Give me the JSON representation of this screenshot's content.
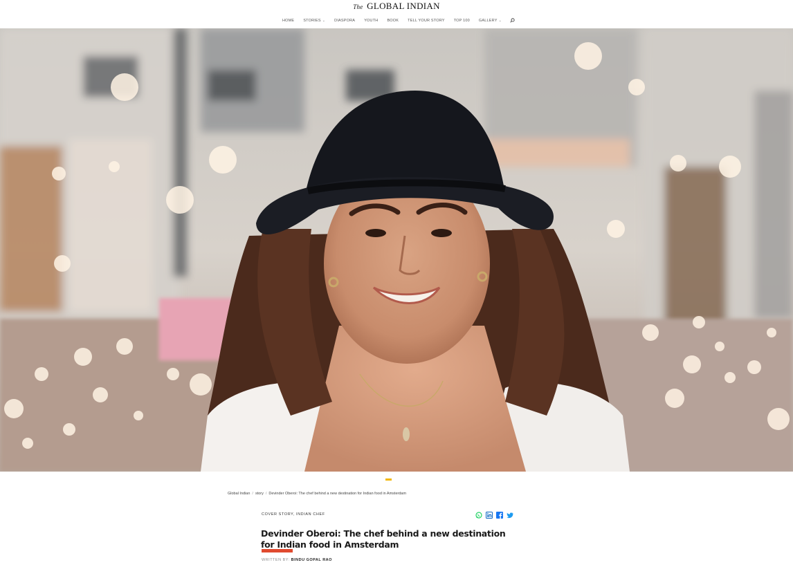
{
  "site": {
    "logo_the": "The",
    "logo_name": "GLOBAL INDIAN"
  },
  "nav": {
    "items": [
      {
        "label": "HOME",
        "has_dropdown": false
      },
      {
        "label": "STORIES",
        "has_dropdown": true
      },
      {
        "label": "DIASPORA",
        "has_dropdown": false
      },
      {
        "label": "YOUTH",
        "has_dropdown": false
      },
      {
        "label": "BOOK",
        "has_dropdown": false
      },
      {
        "label": "TELL YOUR STORY",
        "has_dropdown": false
      },
      {
        "label": "TOP 100",
        "has_dropdown": false
      },
      {
        "label": "GALLERY",
        "has_dropdown": true
      }
    ],
    "search_icon": "search-icon",
    "chevron_icon": "chevron-down-icon"
  },
  "hero": {
    "image_alt": "hero-photo"
  },
  "breadcrumb": {
    "items": [
      "Global Indian",
      "story",
      "Devinder Oberoi: The chef behind a new destination for Indian food in Amsterdam"
    ],
    "separator": "/"
  },
  "article": {
    "categories": "COVER STORY, INDIAN CHEF",
    "title": "Devinder Oberoi: The chef behind a new destination for Indian food in Amsterdam",
    "byline_prefix": "WRITTEN BY:",
    "author": "BINDU GOPAL RAO"
  },
  "share": {
    "icons": [
      "whatsapp-icon",
      "linkedin-icon",
      "facebook-icon",
      "twitter-icon"
    ]
  },
  "colors": {
    "accent_yellow": "#f2b705",
    "accent_red": "#e04a2f",
    "share_whatsapp": "#25d366",
    "share_linkedin": "#0a66c2",
    "share_facebook": "#1877f2",
    "share_twitter": "#1d9bf0"
  }
}
